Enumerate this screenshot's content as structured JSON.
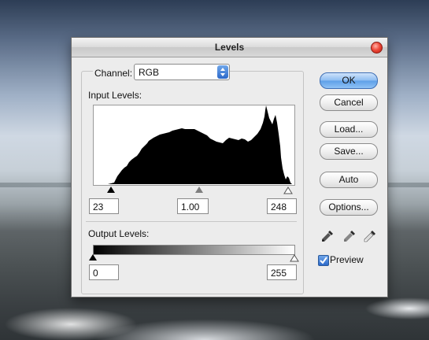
{
  "dialog": {
    "title": "Levels"
  },
  "channel": {
    "label": "Channel:",
    "value": "RGB"
  },
  "input_levels": {
    "label": "Input Levels:",
    "black": "23",
    "gray": "1.00",
    "white": "248"
  },
  "output_levels": {
    "label": "Output Levels:",
    "black": "0",
    "white": "255"
  },
  "buttons": {
    "ok": "OK",
    "cancel": "Cancel",
    "load": "Load...",
    "save": "Save...",
    "auto": "Auto",
    "options": "Options..."
  },
  "preview": {
    "label": "Preview",
    "checked": true
  }
}
